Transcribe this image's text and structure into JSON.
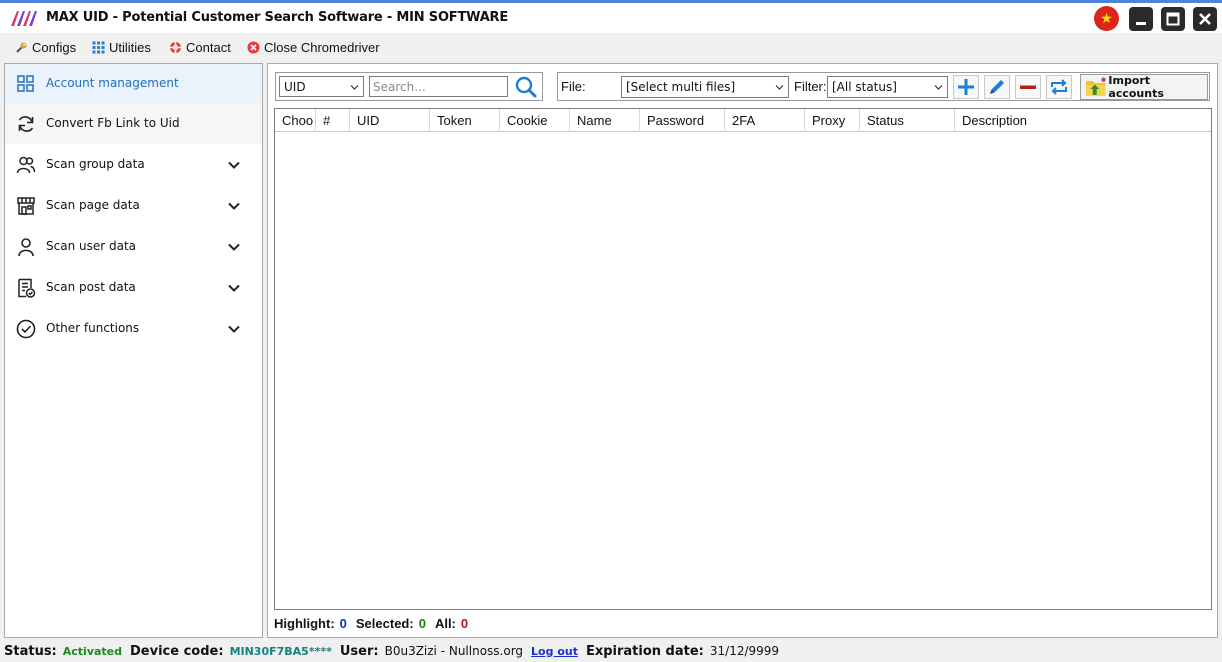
{
  "window": {
    "title": "MAX UID - Potential Customer Search Software - MIN SOFTWARE",
    "flag_glyph": "★"
  },
  "menu": {
    "configs": "Configs",
    "utilities": "Utilities",
    "contact": "Contact",
    "close_chromedriver": "Close Chromedriver"
  },
  "sidebar": {
    "items": [
      {
        "label": "Account management",
        "icon": "grid-icon",
        "active": true,
        "expandable": false
      },
      {
        "label": "Convert Fb Link to Uid",
        "icon": "refresh-icon",
        "active": false,
        "expandable": false
      },
      {
        "label": "Scan group data",
        "icon": "group-icon",
        "active": false,
        "expandable": true
      },
      {
        "label": "Scan page data",
        "icon": "store-icon",
        "active": false,
        "expandable": true
      },
      {
        "label": "Scan user data",
        "icon": "user-icon",
        "active": false,
        "expandable": true
      },
      {
        "label": "Scan post data",
        "icon": "post-check-icon",
        "active": false,
        "expandable": true
      },
      {
        "label": "Other functions",
        "icon": "check-circle-icon",
        "active": false,
        "expandable": true
      }
    ]
  },
  "toolbar": {
    "search_field_selected": "UID",
    "search_placeholder": "Search...",
    "file_label": "File:",
    "file_select_value": "[Select multi files]",
    "filter_label": "Filter:",
    "filter_select_value": "[All status]",
    "import_label": "Import accounts"
  },
  "table": {
    "columns": [
      "Choo",
      "#",
      "UID",
      "Token",
      "Cookie",
      "Name",
      "Password",
      "2FA",
      "Proxy",
      "Status",
      "Description"
    ],
    "rows": []
  },
  "summary": {
    "highlight_label": "Highlight:",
    "highlight_value": "0",
    "selected_label": "Selected:",
    "selected_value": "0",
    "all_label": "All:",
    "all_value": "0"
  },
  "statusbar": {
    "status_label": "Status:",
    "status_value": "Activated",
    "device_label": "Device code:",
    "device_value": "MIN30F7BA5****",
    "user_label": "User:",
    "user_value": "B0u3Zizi - Nullnoss.org",
    "logout_label": "Log out",
    "expiration_label": "Expiration date:",
    "expiration_value": "31/12/9999"
  },
  "colors": {
    "accent_blue": "#1f6fbf",
    "active_bg": "#eaf3fc",
    "status_green": "#1a8a1a",
    "device_teal": "#17807e",
    "summary_blue": "#1030c0",
    "summary_green": "#1a7a1a",
    "summary_red": "#c01010"
  }
}
